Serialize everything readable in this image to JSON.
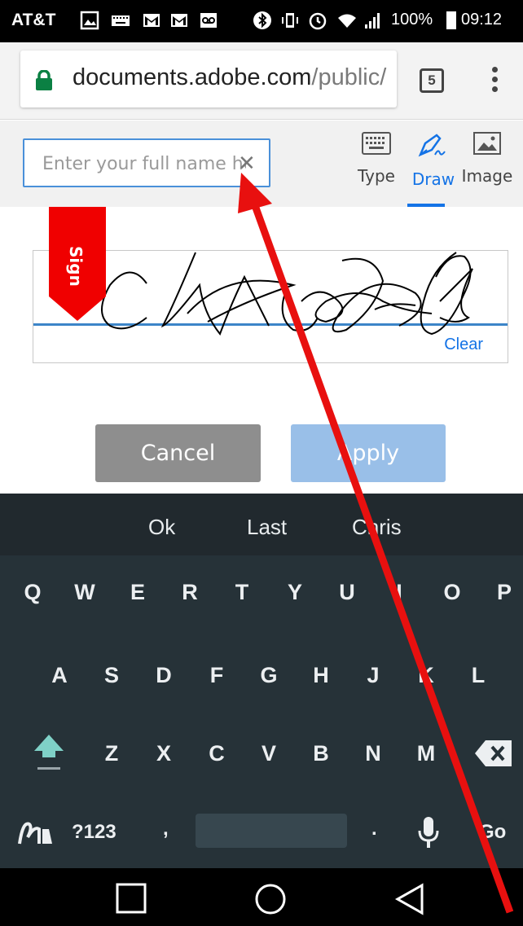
{
  "status_bar": {
    "carrier": "AT&T",
    "battery": "100%",
    "time": "09:12"
  },
  "browser": {
    "url_host": "documents.adobe.com",
    "url_path": "/public/",
    "tab_count": "5"
  },
  "signature": {
    "name_placeholder": "Enter your full name here",
    "modes": [
      {
        "label": "Type",
        "icon": "keyboard-icon"
      },
      {
        "label": "Draw",
        "icon": "pen-icon",
        "active": true
      },
      {
        "label": "Image",
        "icon": "image-icon"
      }
    ],
    "flag_label": "Sign",
    "clear_label": "Clear"
  },
  "buttons": {
    "cancel": "Cancel",
    "apply": "Apply"
  },
  "keyboard": {
    "suggestions": [
      "Ok",
      "Last",
      "Chris"
    ],
    "row1": [
      "Q",
      "W",
      "E",
      "R",
      "T",
      "Y",
      "U",
      "I",
      "O",
      "P"
    ],
    "row2": [
      "A",
      "S",
      "D",
      "F",
      "G",
      "H",
      "J",
      "K",
      "L"
    ],
    "row3": [
      "Z",
      "X",
      "C",
      "V",
      "B",
      "N",
      "M"
    ],
    "symbols": "?123",
    "comma": ",",
    "period": ".",
    "go": "Go"
  },
  "colors": {
    "accent": "#1473e6",
    "annotation_arrow": "#e8100f",
    "sign_flag": "#f00000"
  }
}
